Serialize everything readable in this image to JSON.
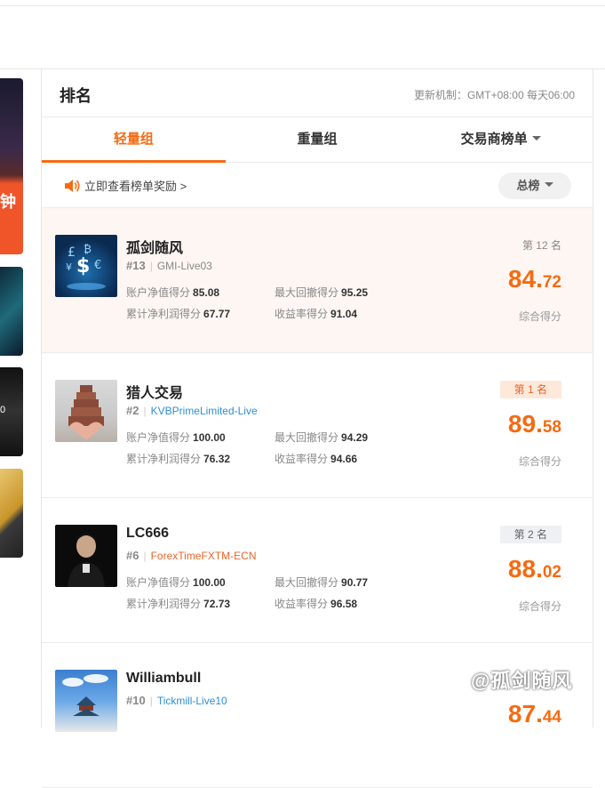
{
  "panel": {
    "title": "排名",
    "update_note": "更新机制：GMT+08:00 每天06:00"
  },
  "tabs": [
    {
      "label": "轻量组",
      "active": true
    },
    {
      "label": "重量组",
      "active": false
    },
    {
      "label": "交易商榜单",
      "active": false
    }
  ],
  "reward_link": "立即查看榜单奖励 >",
  "total_filter": "总榜",
  "left_strip_text": [
    "钟",
    "0"
  ],
  "accent_color": "#f46b12",
  "rows": [
    {
      "name": "孤剑随风",
      "num": "#13",
      "account": "GMI-Live03",
      "rank": "第 12 名",
      "score_int": "84.",
      "score_dec": "72",
      "score_label": "综合得分",
      "m1_label": "账户净值得分",
      "m1_val": "85.08",
      "m2_label": "最大回撤得分",
      "m2_val": "95.25",
      "m3_label": "累计净利润得分",
      "m3_val": "67.77",
      "m4_label": "收益率得分",
      "m4_val": "91.04"
    },
    {
      "name": "猎人交易",
      "num": "#2",
      "account": "KVBPrimeLimited-Live",
      "rank": "第 1 名",
      "score_int": "89.",
      "score_dec": "58",
      "score_label": "综合得分",
      "m1_label": "账户净值得分",
      "m1_val": "100.00",
      "m2_label": "最大回撤得分",
      "m2_val": "94.29",
      "m3_label": "累计净利润得分",
      "m3_val": "76.32",
      "m4_label": "收益率得分",
      "m4_val": "94.66"
    },
    {
      "name": "LC666",
      "num": "#6",
      "account": "ForexTimeFXTM-ECN",
      "rank": "第 2 名",
      "score_int": "88.",
      "score_dec": "02",
      "score_label": "综合得分",
      "m1_label": "账户净值得分",
      "m1_val": "100.00",
      "m2_label": "最大回撤得分",
      "m2_val": "90.77",
      "m3_label": "累计净利润得分",
      "m3_val": "72.73",
      "m4_label": "收益率得分",
      "m4_val": "96.58"
    },
    {
      "name": "Williambull",
      "num": "#10",
      "account": "Tickmill-Live10",
      "score_int": "87.",
      "score_dec": "44"
    }
  ],
  "watermark": "@孤剑随风"
}
